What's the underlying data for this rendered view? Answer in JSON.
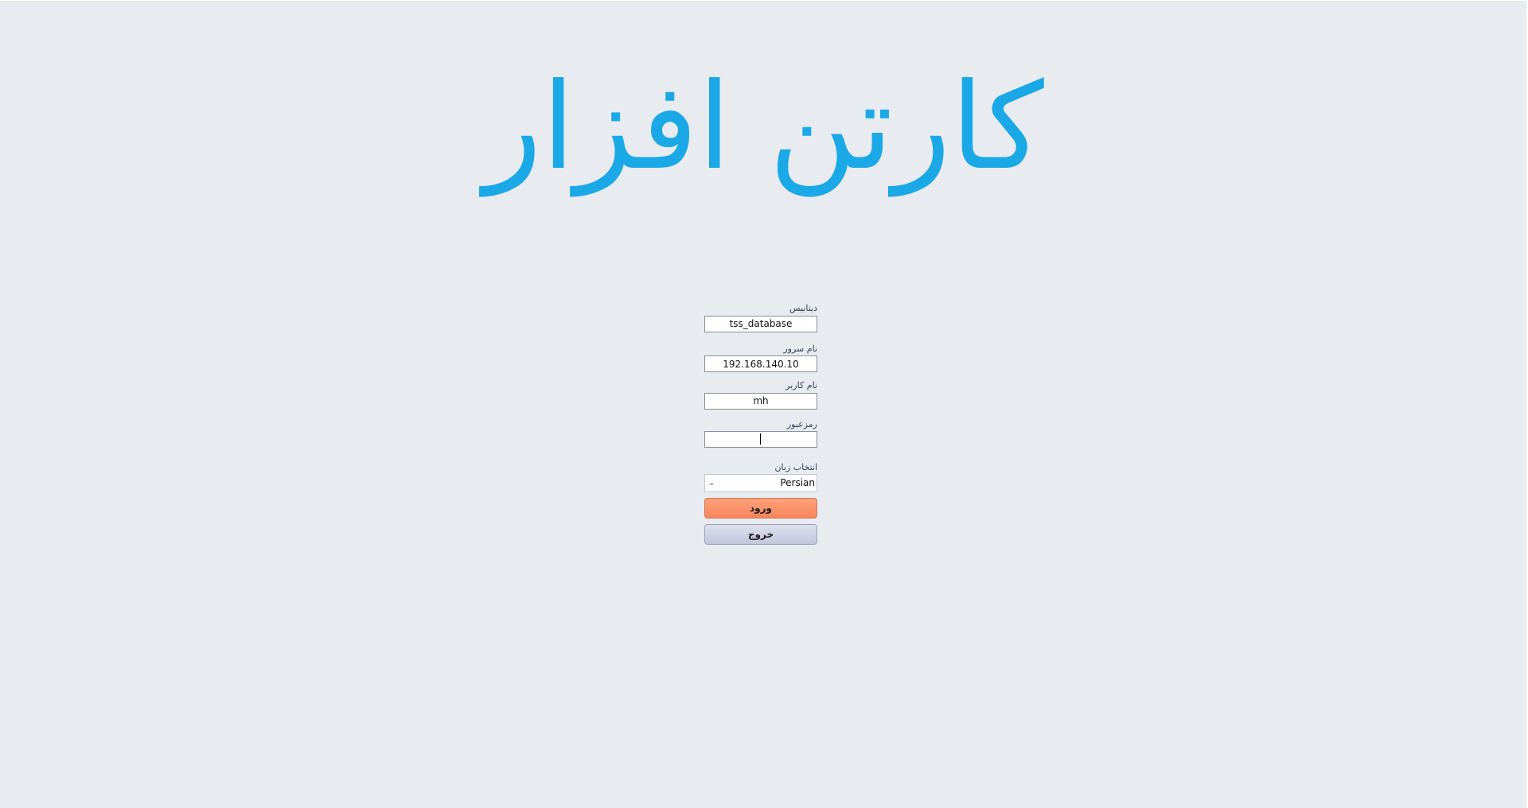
{
  "logo": {
    "text": "کارتن افزار",
    "color": "#1aa9e6"
  },
  "form": {
    "database": {
      "label": "دیتابیس",
      "value": "tss_database"
    },
    "server": {
      "label": "نام سرور",
      "value": "192.168.140.10"
    },
    "username": {
      "label": "نام کاربر",
      "value": "mh"
    },
    "password": {
      "label": "رمزعبور",
      "value": ""
    },
    "language": {
      "label": "انتخاب زبان",
      "selected": "Persian",
      "chevron_icon": "chevron-down-icon"
    },
    "login_button": {
      "label": "ورود",
      "color": "#f8845a"
    },
    "exit_button": {
      "label": "خروج",
      "color": "#c2c6db"
    }
  },
  "colors": {
    "background": "#e8ebf0"
  }
}
